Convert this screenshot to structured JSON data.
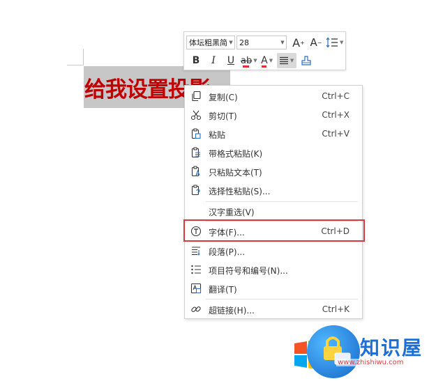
{
  "document": {
    "text": "给我设置投影"
  },
  "mini_toolbar": {
    "font_name": "体坛粗黑简",
    "font_size": "28",
    "grow_font": "A",
    "shrink_font": "A",
    "bold": "B",
    "italic": "I",
    "underline": "U",
    "highlight": "ab",
    "font_color": "A"
  },
  "context_menu": {
    "items": [
      {
        "label": "复制(C)",
        "shortcut": "Ctrl+C"
      },
      {
        "label": "剪切(T)",
        "shortcut": "Ctrl+X"
      },
      {
        "label": "粘贴",
        "shortcut": "Ctrl+V"
      },
      {
        "label": "带格式粘贴(K)",
        "shortcut": ""
      },
      {
        "label": "只粘贴文本(T)",
        "shortcut": ""
      },
      {
        "label": "选择性粘贴(S)...",
        "shortcut": ""
      },
      {
        "label": "汉字重选(V)",
        "shortcut": ""
      },
      {
        "label": "字体(F)...",
        "shortcut": "Ctrl+D"
      },
      {
        "label": "段落(P)...",
        "shortcut": ""
      },
      {
        "label": "项目符号和编号(N)...",
        "shortcut": ""
      },
      {
        "label": "翻译(T)",
        "shortcut": ""
      },
      {
        "label": "超链接(H)...",
        "shortcut": "Ctrl+K"
      }
    ]
  },
  "watermark": {
    "brand": "知识屋",
    "url": "www.zhishiwu.com"
  },
  "colors": {
    "selection": "#c7c7c7",
    "doc_text": "#c00000",
    "highlight_box": "#d9393b"
  }
}
